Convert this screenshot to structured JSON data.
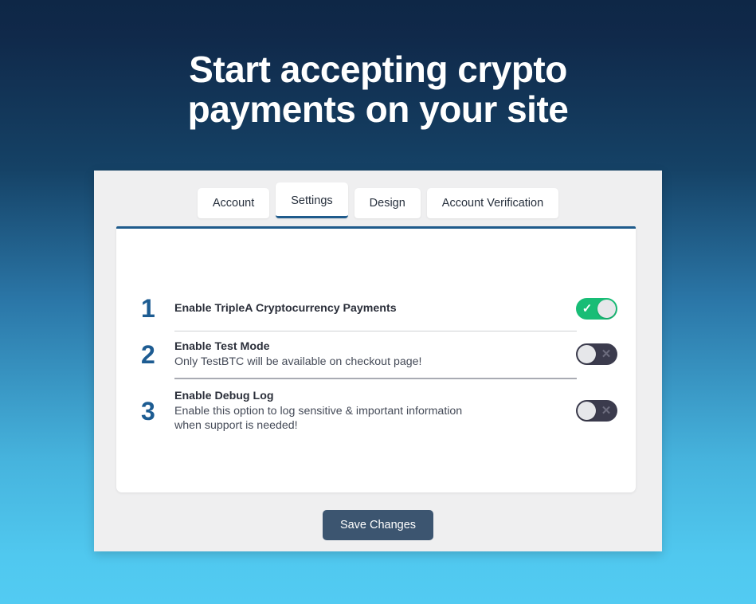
{
  "hero": {
    "title": "Start accepting crypto payments on your site"
  },
  "tabs": [
    {
      "label": "Account",
      "active": false
    },
    {
      "label": "Settings",
      "active": true
    },
    {
      "label": "Design",
      "active": false
    },
    {
      "label": "Account Verification",
      "active": false
    }
  ],
  "settings": {
    "rows": [
      {
        "step": "1",
        "title": "Enable TripleA Cryptocurrency Payments",
        "description": "",
        "toggle_state": "on",
        "toggle_glyph": "✓"
      },
      {
        "step": "2",
        "title": "Enable Test Mode",
        "description": "Only TestBTC will be available on checkout page!",
        "toggle_state": "off",
        "toggle_glyph": "✕"
      },
      {
        "step": "3",
        "title": "Enable Debug Log",
        "description": "Enable this option to log sensitive & important information when support is needed!",
        "toggle_state": "off",
        "toggle_glyph": "✕"
      }
    ]
  },
  "footer": {
    "save_label": "Save Changes"
  },
  "colors": {
    "background_top": "#10294a",
    "background_bottom": "#52cbf2",
    "accent_blue": "#1f5b8c",
    "step_number": "#1d5c92",
    "toggle_on": "#18bd76",
    "toggle_off": "#3b3b4d",
    "save_button": "#3c5570",
    "card_background": "#efeff0",
    "panel_background": "#ffffff"
  }
}
